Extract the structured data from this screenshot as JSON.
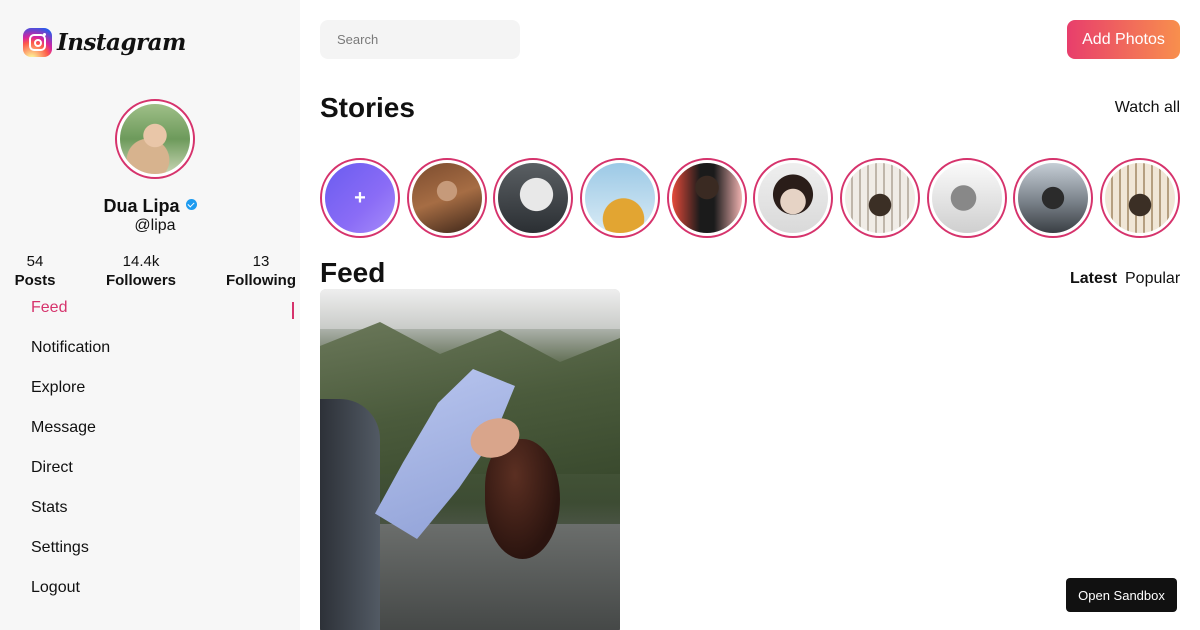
{
  "app": {
    "logo_text": "Instagram"
  },
  "profile": {
    "name": "Dua Lipa",
    "handle": "@lipa",
    "stats": [
      {
        "value": "54",
        "label": "Posts"
      },
      {
        "value": "14.4k",
        "label": "Followers"
      },
      {
        "value": "13",
        "label": "Following"
      }
    ]
  },
  "nav": {
    "items": [
      {
        "label": "Feed",
        "active": true
      },
      {
        "label": "Notification"
      },
      {
        "label": "Explore"
      },
      {
        "label": "Message"
      },
      {
        "label": "Direct"
      },
      {
        "label": "Stats"
      },
      {
        "label": "Settings"
      },
      {
        "label": "Logout"
      }
    ]
  },
  "header": {
    "search_placeholder": "Search",
    "add_button": "Add Photos"
  },
  "stories": {
    "title": "Stories",
    "watch_all": "Watch all",
    "add_symbol": "+"
  },
  "feed": {
    "title": "Feed",
    "tabs": [
      {
        "label": "Latest",
        "active": true
      },
      {
        "label": "Popular"
      }
    ]
  },
  "sandbox": {
    "label": "Open Sandbox"
  },
  "colors": {
    "accent": "#d6336c",
    "button_start": "#e83e6c",
    "button_end": "#f88f4d",
    "verified": "#1d9bf0"
  }
}
